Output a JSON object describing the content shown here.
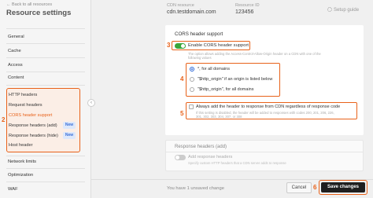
{
  "sidebar": {
    "back": "← Back to all resources",
    "title": "Resource settings",
    "items": [
      "General",
      "Cache",
      "Access",
      "Content"
    ],
    "http_group": {
      "title": "HTTP headers",
      "subitems": [
        {
          "label": "Request headers",
          "badge": ""
        },
        {
          "label": "CORS header support",
          "badge": ""
        },
        {
          "label": "Response headers (add)",
          "badge": "New"
        },
        {
          "label": "Response headers (hide)",
          "badge": "New"
        },
        {
          "label": "Host header",
          "badge": ""
        }
      ]
    },
    "lower_items": [
      "Network limits",
      "Optimization",
      "WAF"
    ]
  },
  "header": {
    "cdn_label": "CDN resource",
    "cdn_value": "cdn.testdomain.com",
    "id_label": "Resource ID",
    "id_value": "123456",
    "setup_guide": "Setup guide"
  },
  "cors": {
    "section_title": "CORS header support",
    "toggle_label": "Enable CORS header support",
    "toggle_on": true,
    "description_line1": "The option allows adding the Access-Control-Allow-Origin header on a CDN with one of the",
    "description_line2": "following values",
    "options": [
      "*, for all domains",
      "\"$http_origin\" if an origin is listed below",
      "\"$http_origin\", for all domains"
    ],
    "selected_option": 0,
    "always_label": "Always add the header to response from CDN regardless of response code",
    "always_desc_line1": "If this setting is disabled, the header will be added to responses with codes 200, 201, 206, 226,",
    "always_desc_line2": "301, 302, 303, 304, 307, or 308"
  },
  "response_add": {
    "title": "Response headers (add)",
    "toggle_label": "Add response headers",
    "toggle_desc": "Specify custom HTTP headers that a CDN server adds to response"
  },
  "footer": {
    "unsaved": "You have 1 unsaved change",
    "cancel": "Cancel",
    "save": "Save changes"
  },
  "annotations": {
    "n2": "2",
    "n3": "3",
    "n4": "4",
    "n5": "5",
    "n6": "6"
  },
  "colors": {
    "annotation": "#e8621a",
    "toggle_on": "#3aa63a",
    "primary_button": "#1f1f1f",
    "badge_text": "#3a6fd8"
  }
}
